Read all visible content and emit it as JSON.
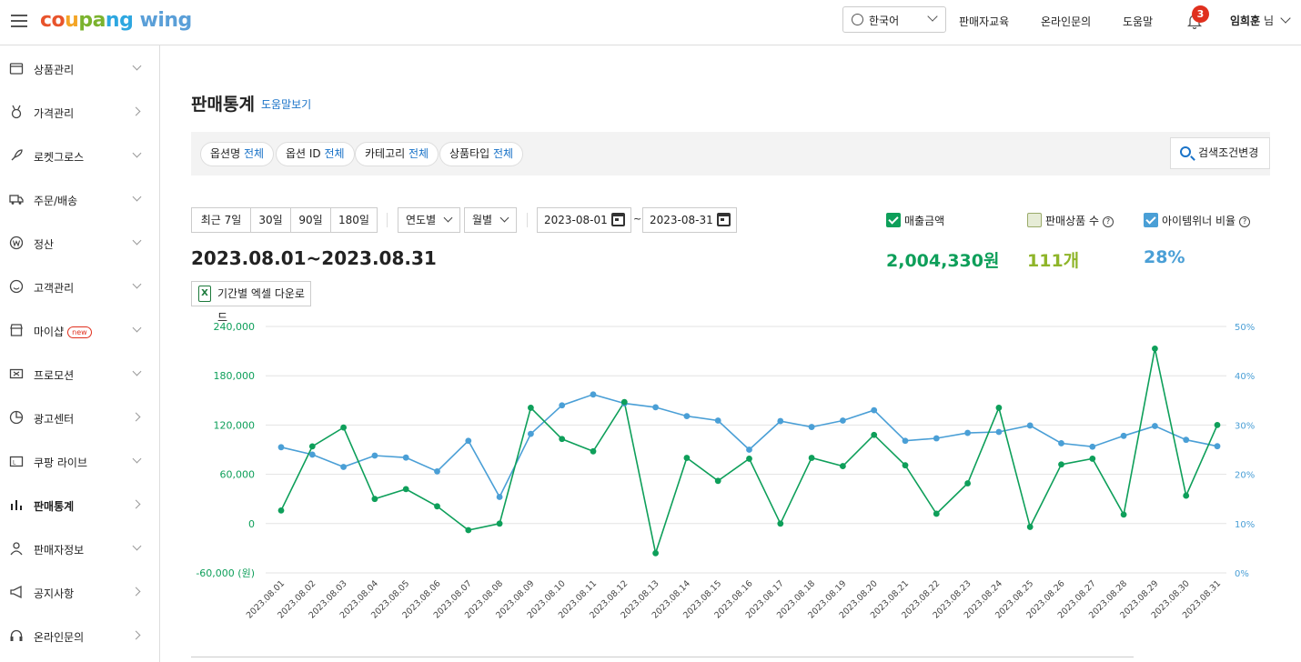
{
  "topbar": {
    "logo": {
      "c1": "co",
      "c2": "u",
      "c3": "pa",
      "c4": "ng",
      "wing": " wing"
    },
    "language": "한국어",
    "links": [
      "판매자교육",
      "온라인문의",
      "도움말"
    ],
    "notification_count": "3",
    "user_name": "임희훈",
    "user_suffix": "님"
  },
  "sidebar": {
    "items": [
      {
        "label": "상품관리",
        "icon": "box-icon",
        "arrow": "down"
      },
      {
        "label": "가격관리",
        "icon": "medal-icon",
        "arrow": "right"
      },
      {
        "label": "로켓그로스",
        "icon": "rocket-icon",
        "arrow": "down"
      },
      {
        "label": "주문/배송",
        "icon": "truck-icon",
        "arrow": "down"
      },
      {
        "label": "정산",
        "icon": "won-coin-icon",
        "arrow": "down"
      },
      {
        "label": "고객관리",
        "icon": "smile-icon",
        "arrow": "down"
      },
      {
        "label": "마이샵",
        "icon": "shop-icon",
        "arrow": "down",
        "badge": "new"
      },
      {
        "label": "프로모션",
        "icon": "ticket-icon",
        "arrow": "down"
      },
      {
        "label": "광고센터",
        "icon": "pie-icon",
        "arrow": "right"
      },
      {
        "label": "쿠팡 라이브",
        "icon": "live-icon",
        "arrow": "down"
      },
      {
        "label": "판매통계",
        "icon": "bar-chart-icon",
        "arrow": "right",
        "active": true
      },
      {
        "label": "판매자정보",
        "icon": "person-icon",
        "arrow": "down"
      },
      {
        "label": "공지사항",
        "icon": "megaphone-icon",
        "arrow": "right"
      },
      {
        "label": "온라인문의",
        "icon": "headset-icon",
        "arrow": "right"
      }
    ]
  },
  "main": {
    "title": "판매통계",
    "help_link": "도움말보기",
    "filters": [
      {
        "label": "옵션명",
        "value": "전체"
      },
      {
        "label": "옵션 ID",
        "value": "전체"
      },
      {
        "label": "카테고리",
        "value": "전체"
      },
      {
        "label": "상품타입",
        "value": "전체"
      }
    ],
    "search_button": "검색조건변경",
    "range_buttons": [
      "최근 7일",
      "30일",
      "90일",
      "180일"
    ],
    "period_select": "연도별",
    "month_select": "월별",
    "date_from": "2023-08-01",
    "date_to": "2023-08-31",
    "date_sep": "~",
    "range_title": "2023.08.01~2023.08.31",
    "excel_button": "기간별 엑셀 다운로드",
    "metrics": [
      {
        "label": "매출금액",
        "value": "2,004,330원",
        "checked": true,
        "color": "#0e9f5a"
      },
      {
        "label": "판매상품 수",
        "value": "111개",
        "checked": false,
        "color": "#8fb52a",
        "help": "?"
      },
      {
        "label": "아이템위너 비율",
        "value": "28%",
        "checked": true,
        "color": "#4a9fd6",
        "help": "?"
      }
    ]
  },
  "chart_data": {
    "type": "line",
    "x": [
      "2023.08.01",
      "2023.08.02",
      "2023.08.03",
      "2023.08.04",
      "2023.08.05",
      "2023.08.06",
      "2023.08.07",
      "2023.08.08",
      "2023.08.09",
      "2023.08.10",
      "2023.08.11",
      "2023.08.12",
      "2023.08.13",
      "2023.08.14",
      "2023.08.15",
      "2023.08.16",
      "2023.08.17",
      "2023.08.18",
      "2023.08.19",
      "2023.08.20",
      "2023.08.21",
      "2023.08.22",
      "2023.08.23",
      "2023.08.24",
      "2023.08.25",
      "2023.08.26",
      "2023.08.27",
      "2023.08.28",
      "2023.08.29",
      "2023.08.30",
      "2023.08.31"
    ],
    "series": [
      {
        "name": "매출금액",
        "axis": "left",
        "color": "#0e9f5a",
        "values": [
          16000,
          94000,
          117000,
          30000,
          42000,
          21000,
          -8000,
          0,
          141000,
          103000,
          88000,
          148000,
          -36000,
          80000,
          52000,
          79000,
          0,
          80000,
          70000,
          108000,
          71000,
          12000,
          49000,
          141000,
          -4000,
          72000,
          79000,
          11000,
          213000,
          34000,
          120000
        ]
      },
      {
        "name": "아이템위너 비율",
        "axis": "right",
        "color": "#4a9fd6",
        "values": [
          25.5,
          24.0,
          21.5,
          23.8,
          23.4,
          20.6,
          26.8,
          15.4,
          28.2,
          34.0,
          36.2,
          34.4,
          33.6,
          31.8,
          30.9,
          25.0,
          30.8,
          29.6,
          30.9,
          33.0,
          26.8,
          27.3,
          28.4,
          28.6,
          29.9,
          26.3,
          25.6,
          27.8,
          29.8,
          27.0,
          25.7
        ]
      }
    ],
    "y_left": {
      "ticks": [
        "240,000",
        "180,000",
        "120,000",
        "60,000",
        "0",
        "-60,000 (원)"
      ],
      "range": [
        -60000,
        240000
      ]
    },
    "y_right": {
      "ticks": [
        "50%",
        "40%",
        "30%",
        "20%",
        "10%",
        "0%"
      ],
      "range": [
        0,
        50
      ]
    },
    "grid": true
  }
}
